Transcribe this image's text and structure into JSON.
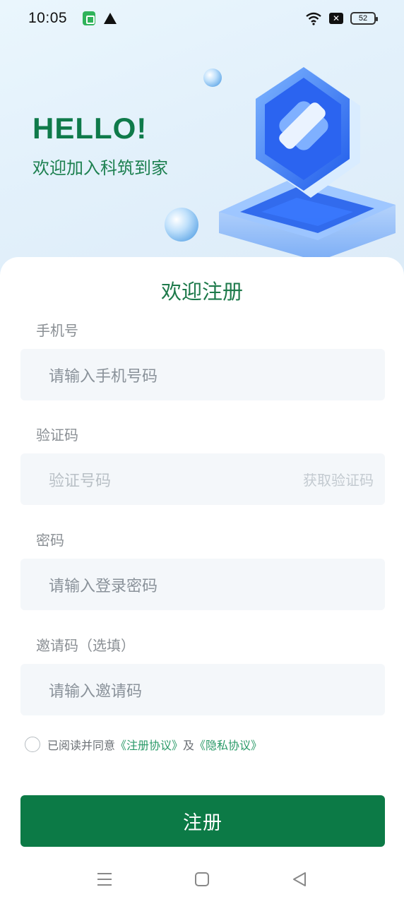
{
  "status_bar": {
    "time": "10:05",
    "battery": "52",
    "icons": [
      "app-notification-icon",
      "warning-icon",
      "wifi-icon",
      "close-box-icon",
      "battery-icon"
    ]
  },
  "hero": {
    "greeting": "HELLO!",
    "subtitle": "欢迎加入科筑到家"
  },
  "form": {
    "title": "欢迎注册",
    "phone": {
      "label": "手机号",
      "placeholder": "请输入手机号码"
    },
    "code": {
      "label": "验证码",
      "placeholder": "验证号码",
      "get_code": "获取验证码"
    },
    "password": {
      "label": "密码",
      "placeholder": "请输入登录密码"
    },
    "invite": {
      "label": "邀请码（选填）",
      "placeholder": "请输入邀请码"
    },
    "agreement": {
      "prefix": "已阅读并同意",
      "terms": "《注册协议》",
      "and": "及",
      "privacy": "《隐私协议》"
    },
    "submit_label": "注册"
  },
  "colors": {
    "brand_green": "#0c7a46",
    "title_green": "#1e7a4b",
    "link_green": "#2a9a68",
    "input_bg": "#f4f7fa"
  }
}
